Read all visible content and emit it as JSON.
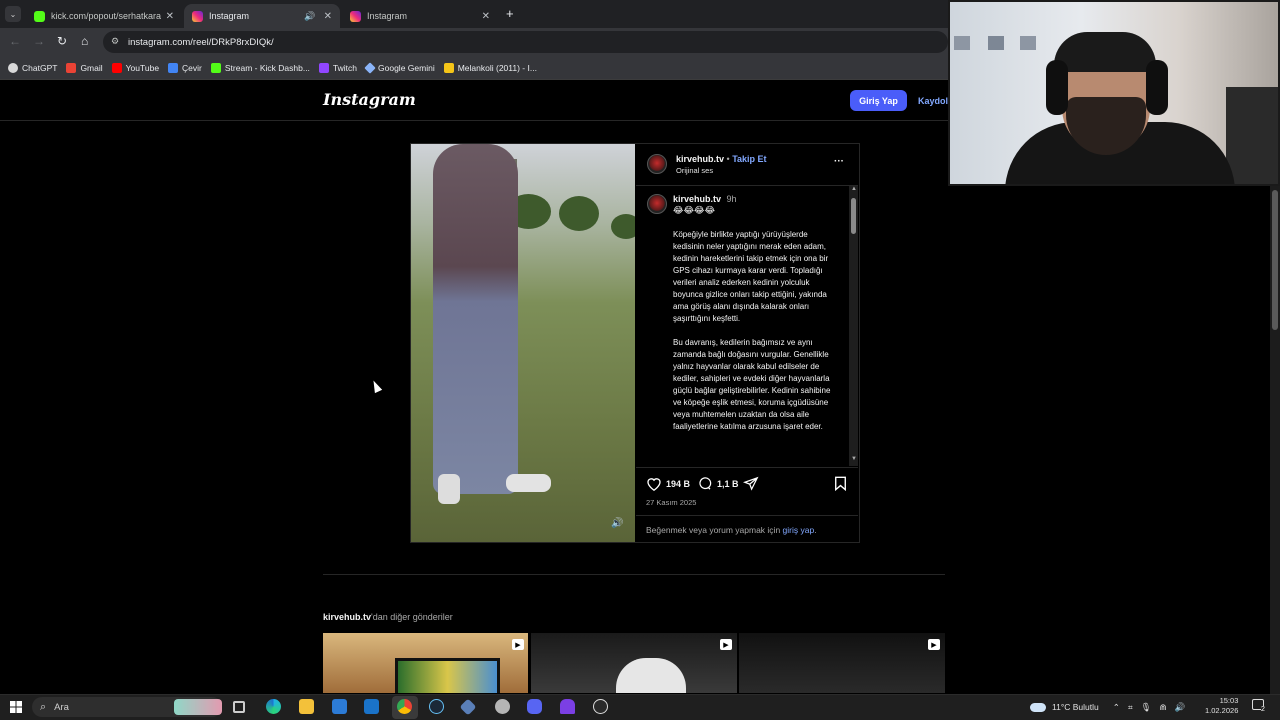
{
  "browser": {
    "tabs": [
      {
        "title": "kick.com/popout/serhatkarahan",
        "color": "#53fc18"
      },
      {
        "title": "Instagram",
        "color": "#e1306c"
      },
      {
        "title": "Instagram",
        "color": "#e1306c"
      }
    ],
    "url": "instagram.com/reel/DRkP8rxDIQk/",
    "bookmarks": [
      {
        "label": "ChatGPT",
        "color": "#d9d9d9"
      },
      {
        "label": "Gmail",
        "color": "#ea4335"
      },
      {
        "label": "YouTube",
        "color": "#ff0000"
      },
      {
        "label": "Çevir",
        "color": "#4285f4"
      },
      {
        "label": "Stream - Kick Dashb...",
        "color": "#53fc18"
      },
      {
        "label": "Twitch",
        "color": "#9146ff"
      },
      {
        "label": "Google Gemini",
        "color": "#8ab4f8"
      },
      {
        "label": "Melankoli (2011) - I...",
        "color": "#f5c518"
      }
    ]
  },
  "instagram": {
    "logo": "Instagram",
    "login_label": "Giriş Yap",
    "signup_label": "Kaydol",
    "post": {
      "username": "kirvehub.tv",
      "follow_label": "Takip Et",
      "follow_sep": "•",
      "audio": "Orijinal ses",
      "more": "···",
      "time": "9h",
      "emojis": "😂😂😂😂",
      "caption_p1": "Köpeğiyle birlikte yaptığı yürüyüşlerde kedisinin neler yaptığını merak eden adam, kedinin hareketlerini takip etmek için ona bir GPS cihazı kurmaya karar verdi. Topladığı verileri analiz ederken kedinin yolculuk boyunca gizlice onları takip ettiğini, yakında ama görüş alanı dışında kalarak onları şaşırttığını keşfetti.",
      "caption_p2": "Bu davranış, kedilerin bağımsız ve aynı zamanda bağlı doğasını vurgular. Genellikle yalnız hayvanlar olarak kabul edilseler de kediler, sahipleri ve evdeki diğer hayvanlarla güçlü bağlar geliştirebilirler. Kedinin sahibine ve köpeğe eşlik etmesi, koruma içgüdüsüne veya muhtemelen uzaktan da olsa aile faaliyetlerine katılma arzusuna işaret eder.",
      "likes": "194 B",
      "comments": "1,1 B",
      "date": "27 Kasım 2025",
      "login_prompt": "Beğenmek veya yorum yapmak için",
      "login_link": "giriş yap",
      "login_end": "."
    },
    "more_posts_user": "kirvehub.tv",
    "more_posts_suffix": "'dan diğer gönderiler"
  },
  "taskbar": {
    "search_placeholder": "Ara",
    "weather": "11°C  Bulutlu",
    "time": "15:03",
    "date": "1.02.2026",
    "notif_count": "2"
  }
}
